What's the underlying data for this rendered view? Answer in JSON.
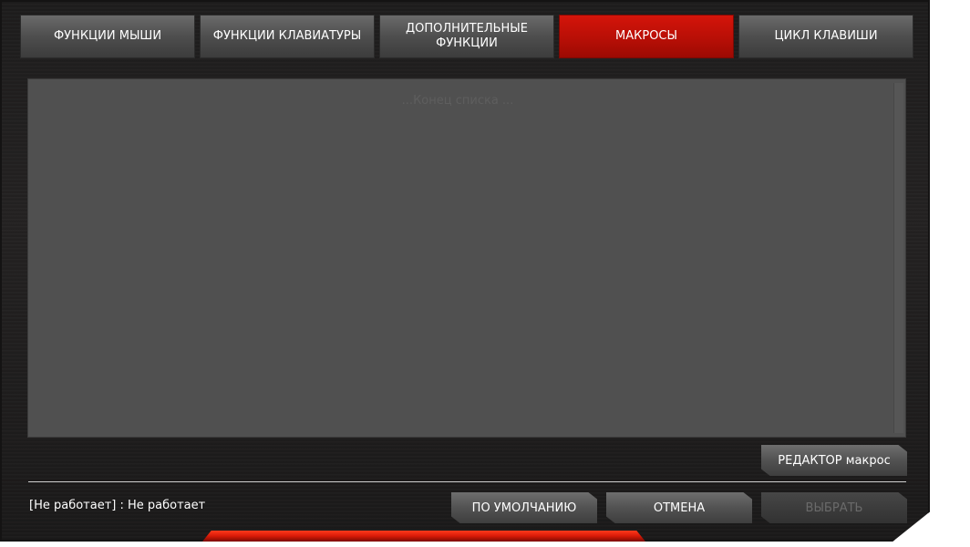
{
  "tabs": [
    {
      "label": "ФУНКЦИИ МЫШИ",
      "active": false
    },
    {
      "label": "ФУНКЦИИ КЛАВИАТУРЫ",
      "active": false
    },
    {
      "label": "ДОПОЛНИТЕЛЬНЫЕ ФУНКЦИИ",
      "active": false
    },
    {
      "label": "МАКРОСЫ",
      "active": true
    },
    {
      "label": "ЦИКЛ КЛАВИШИ",
      "active": false
    }
  ],
  "list": {
    "end_text": "...Конец списка ..."
  },
  "buttons": {
    "macro_editor": "РЕДАКТОР макрос",
    "default": "ПО УМОЛЧАНИЮ",
    "cancel": "ОТМЕНА",
    "select": "ВЫБРАТЬ"
  },
  "status": {
    "text": "[Не работает] : Не работает"
  },
  "colors": {
    "active_tab": "#c8120a",
    "panel": "#505050",
    "background": "#1f1e1e"
  }
}
